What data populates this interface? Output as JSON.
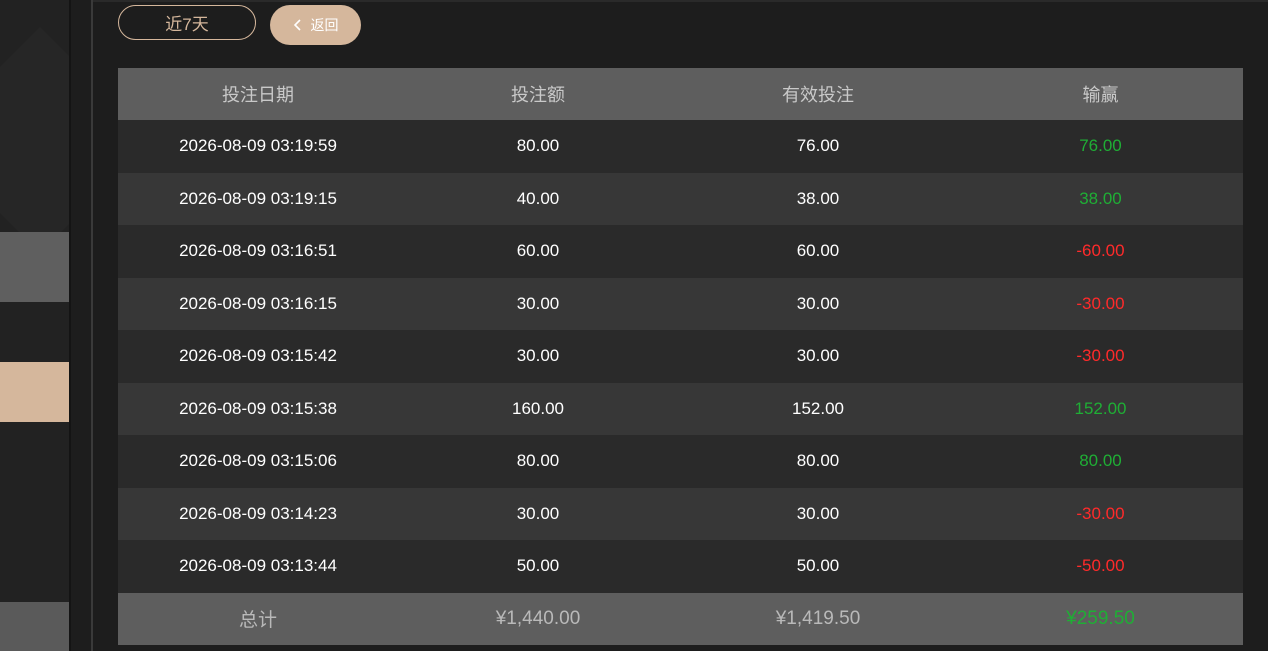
{
  "filters": {
    "range_label": "近7天",
    "back_label": "返回"
  },
  "table": {
    "headers": [
      "投注日期",
      "投注额",
      "有效投注",
      "输赢"
    ],
    "rows": [
      {
        "date": "2026-08-09 03:19:59",
        "amount": "80.00",
        "valid": "76.00",
        "result": "76.00",
        "outcome": "win"
      },
      {
        "date": "2026-08-09 03:19:15",
        "amount": "40.00",
        "valid": "38.00",
        "result": "38.00",
        "outcome": "win"
      },
      {
        "date": "2026-08-09 03:16:51",
        "amount": "60.00",
        "valid": "60.00",
        "result": "-60.00",
        "outcome": "loss"
      },
      {
        "date": "2026-08-09 03:16:15",
        "amount": "30.00",
        "valid": "30.00",
        "result": "-30.00",
        "outcome": "loss"
      },
      {
        "date": "2026-08-09 03:15:42",
        "amount": "30.00",
        "valid": "30.00",
        "result": "-30.00",
        "outcome": "loss"
      },
      {
        "date": "2026-08-09 03:15:38",
        "amount": "160.00",
        "valid": "152.00",
        "result": "152.00",
        "outcome": "win"
      },
      {
        "date": "2026-08-09 03:15:06",
        "amount": "80.00",
        "valid": "80.00",
        "result": "80.00",
        "outcome": "win"
      },
      {
        "date": "2026-08-09 03:14:23",
        "amount": "30.00",
        "valid": "30.00",
        "result": "-30.00",
        "outcome": "loss"
      },
      {
        "date": "2026-08-09 03:13:44",
        "amount": "50.00",
        "valid": "50.00",
        "result": "-50.00",
        "outcome": "loss"
      }
    ],
    "footer": {
      "label": "总计",
      "amount": "¥1,440.00",
      "valid": "¥1,419.50",
      "result": "¥259.50"
    }
  },
  "colors": {
    "accent": "#d5b79c",
    "win": "#1fae35",
    "loss": "#ff2a2a"
  },
  "icons": {
    "back": "chevron-left-icon"
  }
}
